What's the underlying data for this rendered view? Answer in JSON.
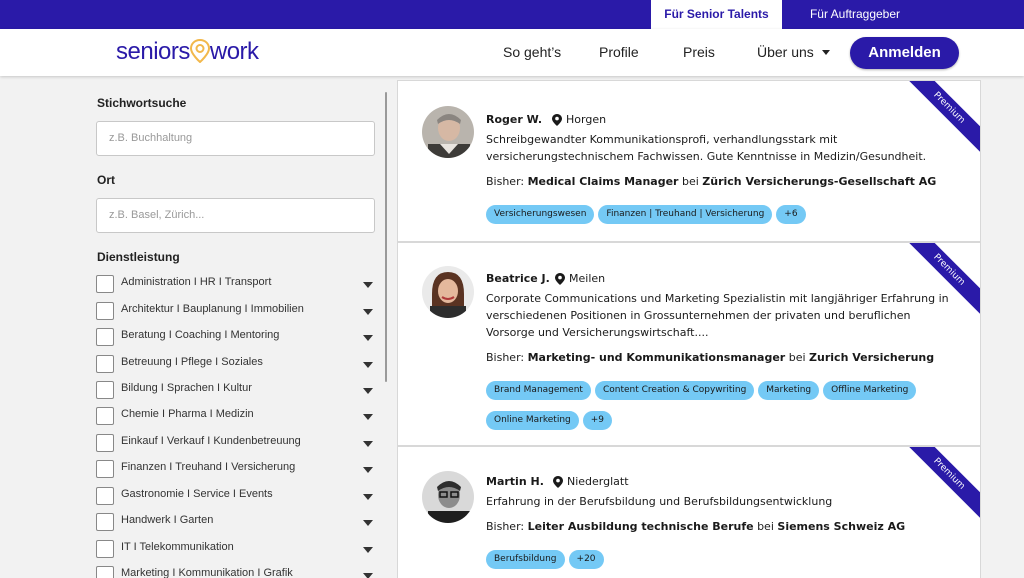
{
  "topbar": {
    "tab_senior": "Für Senior Talents",
    "tab_auftraggeber": "Für Auftraggeber"
  },
  "header": {
    "logo_left": "seniors",
    "logo_right": "work",
    "nav": {
      "so_gehts": "So geht’s",
      "profile": "Profile",
      "preis": "Preis",
      "ueber_uns": "Über uns"
    },
    "login_label": "Anmelden"
  },
  "colors": {
    "brand": "#2a1aa8",
    "tag": "#74c9f5",
    "logo_accent": "#f2b84b"
  },
  "sidebar": {
    "keyword_label": "Stichwortsuche",
    "keyword_placeholder": "z.B. Buchhaltung",
    "location_label": "Ort",
    "location_placeholder": "z.B. Basel, Zürich...",
    "service_label": "Dienstleistung",
    "services": [
      "Administration I HR I Transport",
      "Architektur I Bauplanung I Immobilien",
      "Beratung I Coaching I Mentoring",
      "Betreuung I Pflege I Soziales",
      "Bildung I Sprachen I Kultur",
      "Chemie I Pharma I Medizin",
      "Einkauf I Verkauf I Kundenbetreuung",
      "Finanzen I Treuhand I Versicherung",
      "Gastronomie I Service I Events",
      "Handwerk I Garten",
      "IT I Telekommunikation",
      "Marketing I Kommunikation I Grafik"
    ]
  },
  "results": [
    {
      "name": "Roger W.",
      "location": "Horgen",
      "description": "Schreibgewandter Kommunikationsprofi, verhandlungsstark mit versicherungstechnischem Fachwissen. Gute Kenntnisse in Medizin/Gesundheit.",
      "bisher_prefix": "Bisher:",
      "role": "Medical Claims Manager",
      "bei": "bei",
      "company": "Zürich Versicherungs-Gesellschaft AG",
      "tags": [
        "Versicherungswesen",
        "Finanzen | Treuhand | Versicherung",
        "+6"
      ],
      "ribbon": "Premium"
    },
    {
      "name": "Beatrice J.",
      "location": "Meilen",
      "description": "Corporate Communications und Marketing Spezialistin mit langjähriger Erfahrung in verschiedenen Positionen in Grossunternehmen der privaten und beruflichen Vorsorge und Versicherungswirtschaft....",
      "bisher_prefix": "Bisher:",
      "role": "Marketing- und Kommunikationsmanager",
      "bei": "bei",
      "company": "Zurich Versicherung",
      "tags": [
        "Brand Management",
        "Content Creation & Copywriting",
        "Marketing",
        "Offline Marketing",
        "Online Marketing",
        "+9"
      ],
      "ribbon": "Premium"
    },
    {
      "name": "Martin H.",
      "location": "Niederglatt",
      "description": "Erfahrung in der Berufsbildung und Berufsbildungsentwicklung",
      "bisher_prefix": "Bisher:",
      "role": "Leiter Ausbildung technische Berufe",
      "bei": "bei",
      "company": "Siemens Schweiz AG",
      "tags": [
        "Berufsbildung",
        "+20"
      ],
      "ribbon": "Premium"
    }
  ]
}
